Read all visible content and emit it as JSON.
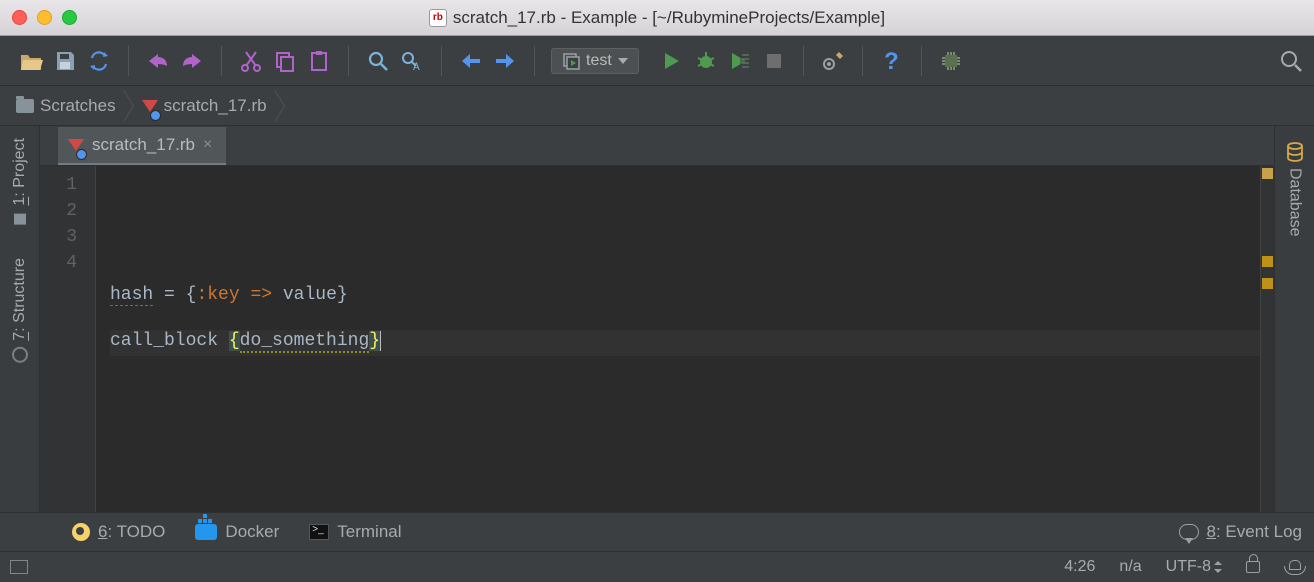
{
  "window": {
    "title": "scratch_17.rb - Example - [~/RubymineProjects/Example]"
  },
  "toolbar": {
    "run_config": "test"
  },
  "breadcrumbs": {
    "root": "Scratches",
    "file": "scratch_17.rb"
  },
  "sidebars": {
    "left": {
      "project_num": "1",
      "project_label": ": Project",
      "structure_num": "7",
      "structure_label": ": Structure"
    },
    "right": {
      "database_label": "Database"
    }
  },
  "tabs": [
    {
      "label": "scratch_17.rb"
    }
  ],
  "editor": {
    "gutter": [
      "1",
      "2",
      "3",
      "4"
    ],
    "line3": {
      "a": "hash",
      "b": " = {",
      "c": ":key",
      "d": " => ",
      "e": "value",
      "f": "}"
    },
    "line4": {
      "a": "call_block ",
      "b": "{",
      "c": "do_something",
      "d": "}"
    }
  },
  "bottom": {
    "todo_num": "6",
    "todo_label": ": TODO",
    "docker": "Docker",
    "terminal": "Terminal",
    "eventlog_num": "8",
    "eventlog_label": ": Event Log"
  },
  "status": {
    "position": "4:26",
    "insert": "n/a",
    "encoding": "UTF-8"
  }
}
